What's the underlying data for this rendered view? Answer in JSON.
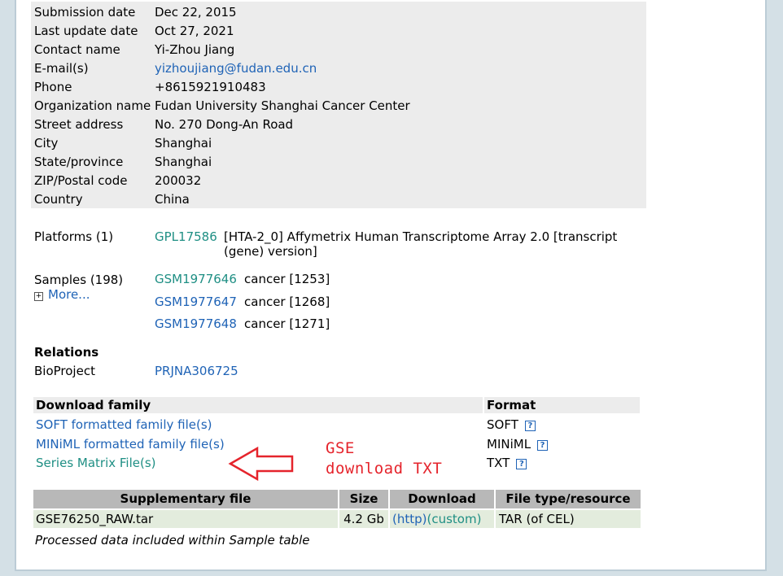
{
  "contact": [
    {
      "label": "Submission date",
      "value": "Dec 22, 2015"
    },
    {
      "label": "Last update date",
      "value": "Oct 27, 2021"
    },
    {
      "label": "Contact name",
      "value": "Yi-Zhou Jiang"
    },
    {
      "label": "E-mail(s)",
      "value": "yizhoujiang@fudan.edu.cn"
    },
    {
      "label": "Phone",
      "value": "+8615921910483"
    },
    {
      "label": "Organization name",
      "value": "Fudan University Shanghai Cancer Center"
    },
    {
      "label": "Street address",
      "value": "No. 270 Dong-An Road"
    },
    {
      "label": "City",
      "value": "Shanghai"
    },
    {
      "label": "State/province",
      "value": "Shanghai"
    },
    {
      "label": "ZIP/Postal code",
      "value": "200032"
    },
    {
      "label": "Country",
      "value": "China"
    }
  ],
  "platforms": {
    "label": "Platforms (1)",
    "id": "GPL17586",
    "desc_line1": "[HTA-2_0] Affymetrix Human Transcriptome Array 2.0 [transcript",
    "desc_line2": "(gene) version]"
  },
  "samples": {
    "label": "Samples (198)",
    "more": "More...",
    "items": [
      {
        "id": "GSM1977646",
        "desc": "cancer [1253]"
      },
      {
        "id": "GSM1977647",
        "desc": "cancer [1268]"
      },
      {
        "id": "GSM1977648",
        "desc": "cancer [1271]"
      }
    ]
  },
  "relations": {
    "heading": "Relations",
    "bioproject_label": "BioProject",
    "bioproject_id": "PRJNA306725"
  },
  "download_family": {
    "header": "Download family",
    "format_header": "Format",
    "rows": [
      {
        "label": "SOFT formatted family file(s)",
        "format": "SOFT"
      },
      {
        "label": "MINiML formatted family file(s)",
        "format": "MINiML"
      },
      {
        "label": "Series Matrix File(s)",
        "format": "TXT"
      }
    ]
  },
  "annotation": {
    "line1": "GSE",
    "line2": "download TXT",
    "color": "#e5242c"
  },
  "supplementary": {
    "headers": [
      "Supplementary file",
      "Size",
      "Download",
      "File type/resource"
    ],
    "row": {
      "file": "GSE76250_RAW.tar",
      "size": "4.2 Gb",
      "http": "(http)",
      "custom": "(custom)",
      "type": "TAR (of CEL)"
    },
    "note": "Processed data included within Sample table"
  }
}
